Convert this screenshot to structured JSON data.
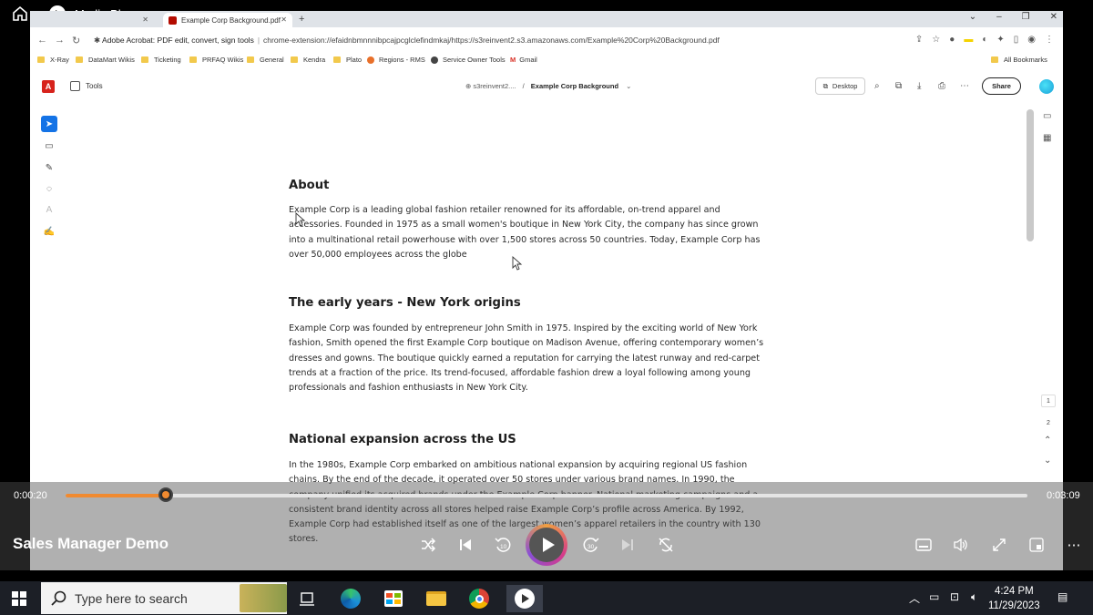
{
  "media_player": {
    "app_title": "Media Player",
    "media_title": "Sales Manager Demo",
    "elapsed": "0:00:20",
    "duration": "0:03:09",
    "progress_fraction": 0.104,
    "accent_color": "#f08a30"
  },
  "browser": {
    "tabs": [
      {
        "label": ""
      },
      {
        "label": "Example Corp Background.pdf"
      }
    ],
    "url_host": "Adobe Acrobat: PDF edit, convert, sign tools",
    "url_path": "chrome-extension://efaidnbmnnnibpcajpcglclefindmkaj/https://s3reinvent2.s3.amazonaws.com/Example%20Corp%20Background.pdf",
    "bookmarks": [
      {
        "label": "X-Ray"
      },
      {
        "label": "DataMart Wikis"
      },
      {
        "label": "Ticketing"
      },
      {
        "label": "PRFAQ Wikis"
      },
      {
        "label": "General"
      },
      {
        "label": "Kendra"
      },
      {
        "label": "Plato"
      },
      {
        "label": "Regions - RMS"
      },
      {
        "label": "Service Owner Tools"
      },
      {
        "label": "Gmail"
      }
    ],
    "all_bookmarks": "All Bookmarks"
  },
  "acrobat": {
    "tools_label": "Tools",
    "crumb_host": "s3reinvent2....",
    "crumb_sep": "/",
    "doc_name": "Example Corp Background",
    "desktop_label": "Desktop",
    "share_label": "Share",
    "page_numbers": [
      "1",
      "2"
    ]
  },
  "document": {
    "sections": [
      {
        "heading": "About",
        "body": "Example Corp is a leading global fashion retailer renowned for its affordable, on-trend apparel and accessories. Founded in 1975 as a small women's boutique in New York City, the company has since grown into a multinational retail powerhouse with over 1,500 stores across 50 countries. Today, Example Corp has over 50,000 employees across the globe"
      },
      {
        "heading": "The early years - New York origins",
        "body": "Example Corp was founded by entrepreneur John Smith in 1975. Inspired by the exciting world of New York fashion, Smith opened the first Example Corp boutique on Madison Avenue, offering contemporary women’s dresses and gowns. The boutique quickly earned a reputation for carrying the latest runway and red-carpet trends at a fraction of the price. Its trend-focused, affordable fashion drew a loyal following among young professionals and fashion enthusiasts in New York City."
      },
      {
        "heading": "National expansion across the US",
        "body": "In the 1980s, Example Corp embarked on ambitious national expansion by acquiring regional US fashion chains. By the end of the decade, it operated over 50 stores under various brand names. In 1990, the company unified its acquired brands under the Example Corp banner. National marketing campaigns and a consistent brand identity across all stores helped raise Example Corp’s profile across America. By 1992, Example Corp had established itself as one of the largest women’s apparel retailers in the country with 130 stores."
      }
    ]
  },
  "taskbar": {
    "search_placeholder": "Type here to search",
    "time": "4:24 PM",
    "date": "11/29/2023"
  }
}
